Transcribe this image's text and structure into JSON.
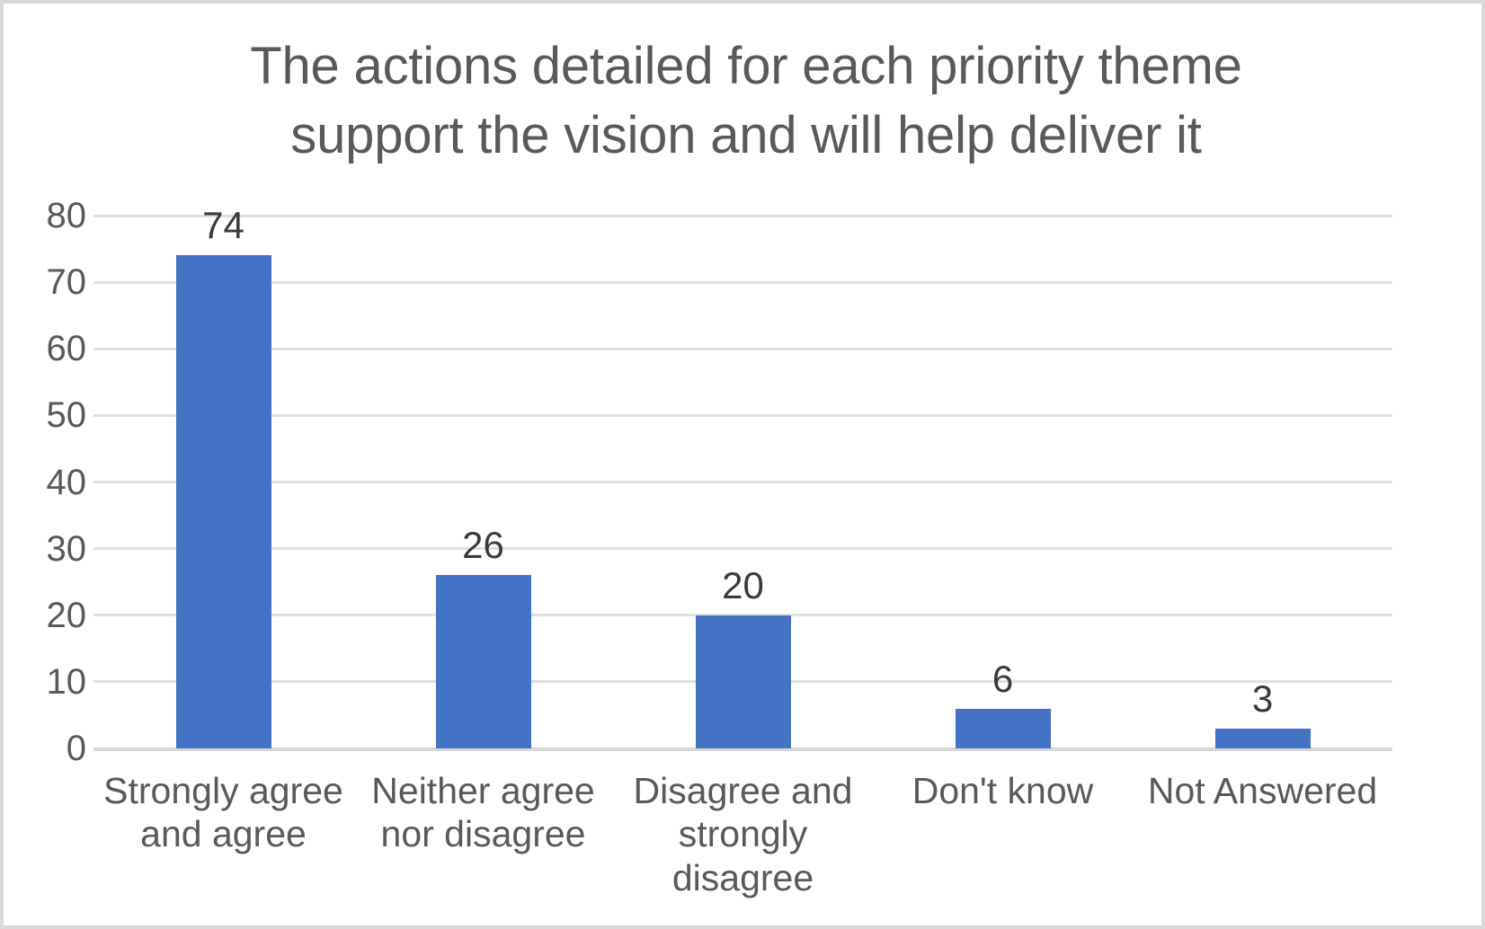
{
  "chart_data": {
    "type": "bar",
    "title": "The actions detailed for each priority theme\nsupport the vision and will help deliver it",
    "title_line1": "The actions detailed for each priority theme",
    "title_line2": "support the vision and will help deliver it",
    "xlabel": "",
    "ylabel": "",
    "ylim": [
      0,
      80
    ],
    "ytick_step": 10,
    "grid": true,
    "legend": false,
    "legend_position": "none",
    "bar_color": "#4472C4",
    "title_color": "#595959",
    "tick_label_color": "#595959",
    "data_label_color": "#3A3A3A",
    "gridline_color": "#E0E0E0",
    "border_color": "#D9D9D9",
    "categories": [
      "Strongly agree\nand agree",
      "Neither agree\nnor disagree",
      "Disagree and\nstrongly disagree",
      "Don't know",
      "Not Answered"
    ],
    "values": [
      74,
      26,
      20,
      6,
      3
    ],
    "data_labels": [
      "74",
      "26",
      "20",
      "6",
      "3"
    ],
    "ytick_labels": [
      "80",
      "70",
      "60",
      "50",
      "40",
      "30",
      "20",
      "10",
      "0"
    ],
    "ytick_values": [
      80,
      70,
      60,
      50,
      40,
      30,
      20,
      10,
      0
    ]
  }
}
